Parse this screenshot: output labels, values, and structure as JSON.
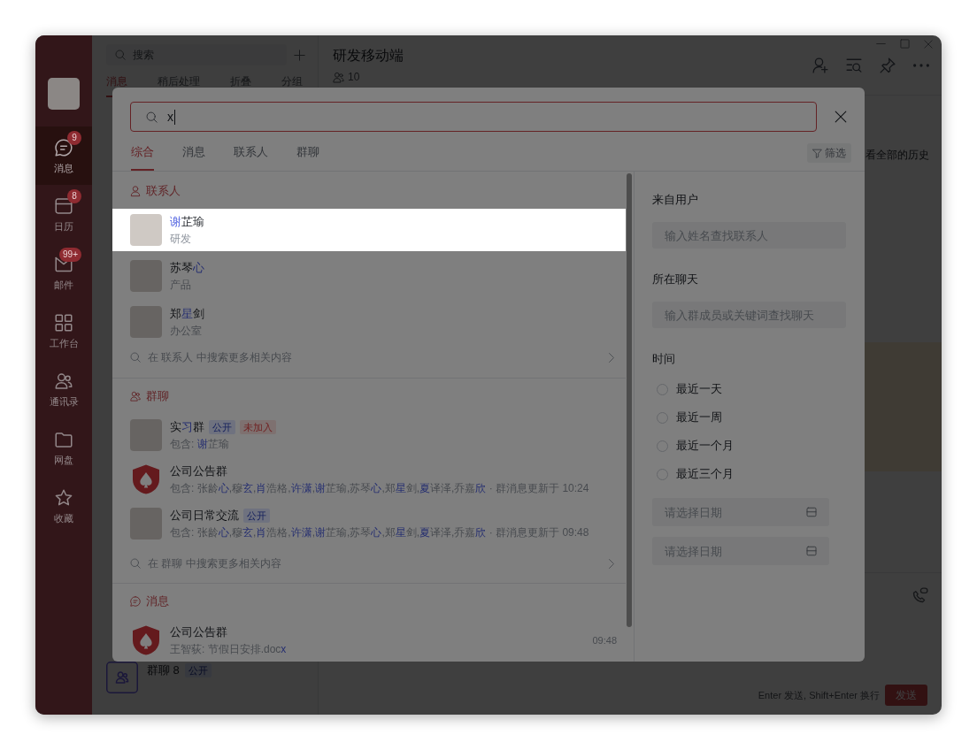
{
  "sidebar": {
    "items": [
      {
        "label": "消息",
        "badge": "9",
        "selected": true
      },
      {
        "label": "日历",
        "badge": "8",
        "selected": false
      },
      {
        "label": "邮件",
        "badge": "99+",
        "selected": false
      },
      {
        "label": "工作台",
        "selected": false
      },
      {
        "label": "通讯录",
        "selected": false
      },
      {
        "label": "网盘",
        "selected": false
      },
      {
        "label": "收藏",
        "selected": false
      }
    ]
  },
  "conversation_panel": {
    "search": {
      "placeholder": "搜索"
    },
    "tabs": [
      {
        "label": "消息",
        "selected": true
      },
      {
        "label": "稍后处理",
        "selected": false
      },
      {
        "label": "折叠",
        "selected": false
      },
      {
        "label": "分组",
        "selected": false
      }
    ],
    "items": [
      {
        "name": "群聊 8",
        "badges": [
          {
            "label": "公开",
            "kind": "public"
          }
        ]
      }
    ]
  },
  "chat": {
    "title": "研发移动端",
    "member_count": "10",
    "history_link": "看全部的历史",
    "composer": {
      "hint": "Enter 发送, Shift+Enter 换行",
      "send_button": "发送"
    }
  },
  "search_dialog": {
    "query": "x",
    "tabs": [
      {
        "label": "综合",
        "selected": true
      },
      {
        "label": "消息",
        "selected": false
      },
      {
        "label": "联系人",
        "selected": false
      },
      {
        "label": "群聊",
        "selected": false
      }
    ],
    "filter_button": "筛选",
    "sections": [
      {
        "kind": "contacts",
        "title": "联系人",
        "items": [
          {
            "name": [
              {
                "text": "谢",
                "hit": true
              },
              {
                "text": "芷瑜",
                "hit": false
              }
            ],
            "department": "研发",
            "highlighted": true
          },
          {
            "name": [
              {
                "text": "苏琴",
                "hit": false
              },
              {
                "text": "心",
                "hit": true
              }
            ],
            "department": "产品",
            "highlighted": false
          },
          {
            "name": [
              {
                "text": "郑",
                "hit": false
              },
              {
                "text": "星",
                "hit": true
              },
              {
                "text": "剑",
                "hit": false
              }
            ],
            "department": "办公室",
            "highlighted": false
          }
        ],
        "more": "在 联系人 中搜索更多相关内容"
      },
      {
        "kind": "groups",
        "title": "群聊",
        "items": [
          {
            "kind": "photo",
            "name": [
              {
                "text": "实",
                "hit": false
              },
              {
                "text": "习",
                "hit": true
              },
              {
                "text": "群",
                "hit": false
              }
            ],
            "badges": [
              {
                "label": "公开",
                "kind": "public"
              },
              {
                "label": "未加入",
                "kind": "not_joined"
              }
            ],
            "detail": [
              {
                "text": "包含: ",
                "hit": false
              },
              {
                "text": "谢",
                "hit": true
              },
              {
                "text": "芷瑜",
                "hit": false
              }
            ]
          },
          {
            "kind": "logo",
            "name": "公司公告群",
            "detail": [
              {
                "text": "包含: 张龄",
                "hit": false
              },
              {
                "text": "心",
                "hit": true
              },
              {
                "text": ",穆",
                "hit": false
              },
              {
                "text": "玄",
                "hit": true
              },
              {
                "text": ",",
                "hit": false
              },
              {
                "text": "肖",
                "hit": true
              },
              {
                "text": "浩格,",
                "hit": false
              },
              {
                "text": "许潇",
                "hit": true
              },
              {
                "text": ",",
                "hit": false
              },
              {
                "text": "谢",
                "hit": true
              },
              {
                "text": "芷瑜,苏琴",
                "hit": false
              },
              {
                "text": "心",
                "hit": true
              },
              {
                "text": ",郑",
                "hit": false
              },
              {
                "text": "星",
                "hit": true
              },
              {
                "text": "剑,",
                "hit": false
              },
              {
                "text": "夏",
                "hit": true
              },
              {
                "text": "译泽,乔嘉",
                "hit": false
              },
              {
                "text": "欣",
                "hit": true
              },
              {
                "text": " · 群消息更新于 10:24",
                "hit": false
              }
            ]
          },
          {
            "kind": "photo",
            "name": "公司日常交流",
            "badges": [
              {
                "label": "公开",
                "kind": "public"
              }
            ],
            "detail": [
              {
                "text": "包含: 张龄",
                "hit": false
              },
              {
                "text": "心",
                "hit": true
              },
              {
                "text": ",穆",
                "hit": false
              },
              {
                "text": "玄",
                "hit": true
              },
              {
                "text": ",",
                "hit": false
              },
              {
                "text": "肖",
                "hit": true
              },
              {
                "text": "浩格,",
                "hit": false
              },
              {
                "text": "许潇",
                "hit": true
              },
              {
                "text": ",",
                "hit": false
              },
              {
                "text": "谢",
                "hit": true
              },
              {
                "text": "芷瑜,苏琴",
                "hit": false
              },
              {
                "text": "心",
                "hit": true
              },
              {
                "text": ",郑",
                "hit": false
              },
              {
                "text": "星",
                "hit": true
              },
              {
                "text": "剑,",
                "hit": false
              },
              {
                "text": "夏",
                "hit": true
              },
              {
                "text": "译泽,乔嘉",
                "hit": false
              },
              {
                "text": "欣",
                "hit": true
              },
              {
                "text": " · 群消息更新于 09:48",
                "hit": false
              }
            ]
          }
        ],
        "more": "在 群聊 中搜索更多相关内容"
      },
      {
        "kind": "messages",
        "title": "消息",
        "items": [
          {
            "kind": "logo",
            "name": "公司公告群",
            "preview": [
              {
                "text": "王智荻: 节假日安排.doc",
                "hit": false
              },
              {
                "text": "x",
                "hit": true
              }
            ],
            "time": "09:48"
          }
        ]
      }
    ],
    "filters": {
      "from_user": {
        "label": "来自用户",
        "placeholder": "输入姓名查找联系人"
      },
      "in_chat": {
        "label": "所在聊天",
        "placeholder": "输入群成员或关键词查找聊天"
      },
      "time": {
        "label": "时间",
        "options": [
          {
            "label": "最近一天",
            "selected": false
          },
          {
            "label": "最近一周",
            "selected": false
          },
          {
            "label": "最近一个月",
            "selected": false
          },
          {
            "label": "最近三个月",
            "selected": false
          }
        ],
        "date_fields": [
          {
            "placeholder": "请选择日期"
          },
          {
            "placeholder": "请选择日期"
          }
        ]
      }
    }
  }
}
